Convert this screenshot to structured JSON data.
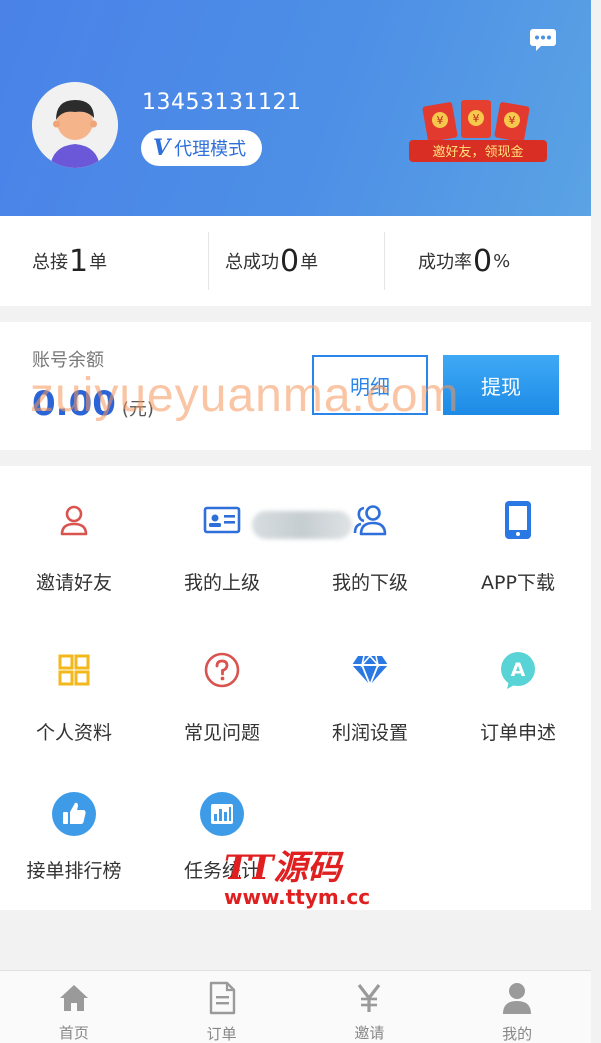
{
  "header": {
    "phone": "13453131121",
    "mode_badge": "代理模式",
    "mode_prefix": "V",
    "promo_text": "邀好友，领现金"
  },
  "stats": [
    {
      "prefix": "总接",
      "value": "1",
      "suffix": "单"
    },
    {
      "prefix": "总成功",
      "value": "0",
      "suffix": "单"
    },
    {
      "prefix": "成功率",
      "value": "0",
      "suffix": "%"
    }
  ],
  "balance": {
    "label": "账号余额",
    "amount": "0.00",
    "unit": "(元)",
    "detail_button": "明细",
    "withdraw_button": "提现"
  },
  "watermark": "zuiyueyuanma.com",
  "menu": [
    {
      "label": "邀请好友",
      "icon": "user-icon"
    },
    {
      "label": "我的上级",
      "icon": "id-card-icon"
    },
    {
      "label": "我的下级",
      "icon": "users-icon"
    },
    {
      "label": "APP下载",
      "icon": "phone-icon"
    },
    {
      "label": "个人资料",
      "icon": "grid-icon"
    },
    {
      "label": "常见问题",
      "icon": "question-icon"
    },
    {
      "label": "利润设置",
      "icon": "diamond-icon"
    },
    {
      "label": "订单申述",
      "icon": "appeal-icon"
    },
    {
      "label": "接单排行榜",
      "icon": "thumbs-up-icon"
    },
    {
      "label": "任务统计",
      "icon": "chart-icon"
    }
  ],
  "logo_watermark": {
    "big": "TT源码",
    "small": "www.ttym.cc"
  },
  "tabbar": [
    {
      "label": "首页",
      "icon": "home-icon"
    },
    {
      "label": "订单",
      "icon": "document-icon"
    },
    {
      "label": "邀请",
      "icon": "yen-icon"
    },
    {
      "label": "我的",
      "icon": "person-icon"
    }
  ],
  "colors": {
    "header": "#4d8fe6",
    "accent": "#2a85e8",
    "danger": "#d9534f"
  }
}
